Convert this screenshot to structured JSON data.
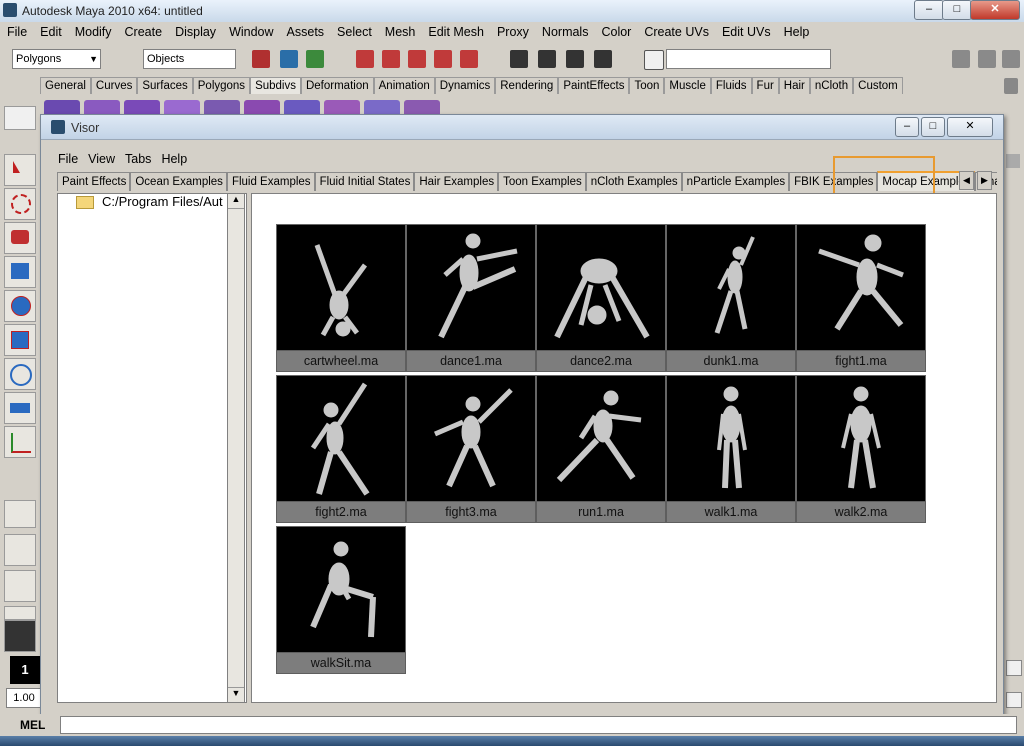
{
  "app": {
    "title": "Autodesk Maya 2010 x64: untitled",
    "window_controls": [
      "–",
      "□",
      "✕"
    ]
  },
  "menubar": [
    "File",
    "Edit",
    "Modify",
    "Create",
    "Display",
    "Window",
    "Assets",
    "Select",
    "Mesh",
    "Edit Mesh",
    "Proxy",
    "Normals",
    "Color",
    "Create UVs",
    "Edit UVs",
    "Help"
  ],
  "status": {
    "mode_dropdown": "Polygons",
    "selection_field": "Objects",
    "command_field": ""
  },
  "shelf": {
    "tabs": [
      "General",
      "Curves",
      "Surfaces",
      "Polygons",
      "Subdivs",
      "Deformation",
      "Animation",
      "Dynamics",
      "Rendering",
      "PaintEffects",
      "Toon",
      "Muscle",
      "Fluids",
      "Fur",
      "Hair",
      "nCloth",
      "Custom"
    ],
    "active_tab": "Subdivs"
  },
  "visor": {
    "title": "Visor",
    "menus": [
      "File",
      "View",
      "Tabs",
      "Help"
    ],
    "tabs": [
      "Paint Effects",
      "Ocean Examples",
      "Fluid Examples",
      "Fluid Initial States",
      "Hair Examples",
      "Toon Examples",
      "nCloth Examples",
      "nParticle Examples",
      "FBIK Examples",
      "Mocap Examples",
      "Chara"
    ],
    "active_tab": "Mocap Examples",
    "tree_path": "C:/Program Files/Aut",
    "thumbnails": [
      "cartwheel.ma",
      "dance1.ma",
      "dance2.ma",
      "dunk1.ma",
      "fight1.ma",
      "fight2.ma",
      "fight3.ma",
      "run1.ma",
      "walk1.ma",
      "walk2.ma",
      "walkSit.ma"
    ]
  },
  "timeline": {
    "current_frame": "1",
    "playback_speed": "1.00"
  },
  "command_line": {
    "label": "MEL"
  },
  "colors": {
    "highlight": "#e89a30",
    "caption_bg": "#7d7d7d"
  }
}
